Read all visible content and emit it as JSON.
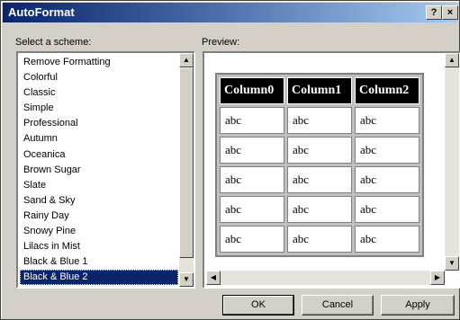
{
  "window": {
    "title": "AutoFormat",
    "help_glyph": "?",
    "close_glyph": "×"
  },
  "scheme": {
    "label": "Select a scheme:",
    "items": [
      "Remove Formatting",
      "Colorful",
      "Classic",
      "Simple",
      "Professional",
      "Autumn",
      "Oceanica",
      "Brown Sugar",
      "Slate",
      "Sand & Sky",
      "Rainy Day",
      "Snowy Pine",
      "Lilacs in Mist",
      "Black & Blue 1",
      "Black & Blue 2"
    ],
    "selected": "Black & Blue 2"
  },
  "preview": {
    "label": "Preview:",
    "headers": [
      "Column0",
      "Column1",
      "Column2"
    ],
    "rows": [
      [
        "abc",
        "abc",
        "abc"
      ],
      [
        "abc",
        "abc",
        "abc"
      ],
      [
        "abc",
        "abc",
        "abc"
      ],
      [
        "abc",
        "abc",
        "abc"
      ],
      [
        "abc",
        "abc",
        "abc"
      ]
    ]
  },
  "buttons": {
    "ok": "OK",
    "cancel": "Cancel",
    "apply": "Apply"
  }
}
